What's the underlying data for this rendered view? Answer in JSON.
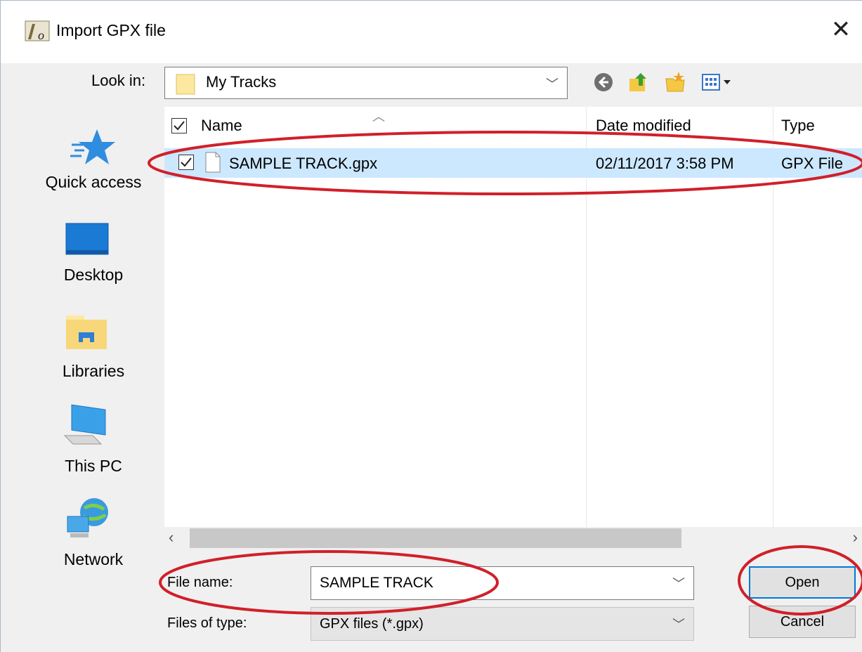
{
  "window": {
    "title": "Import GPX file"
  },
  "lookin": {
    "label": "Look in:",
    "value": "My Tracks"
  },
  "places": [
    {
      "label": "Quick access",
      "icon": "star-icon"
    },
    {
      "label": "Desktop",
      "icon": "desktop-icon"
    },
    {
      "label": "Libraries",
      "icon": "libraries-icon"
    },
    {
      "label": "This PC",
      "icon": "computer-icon"
    },
    {
      "label": "Network",
      "icon": "network-icon"
    }
  ],
  "list": {
    "columns": {
      "name": "Name",
      "date": "Date modified",
      "type": "Type"
    },
    "rows": [
      {
        "name": "SAMPLE TRACK.gpx",
        "date": "02/11/2017 3:58 PM",
        "type": "GPX File",
        "selected": true,
        "checked": true
      }
    ]
  },
  "filename": {
    "label": "File name:",
    "value": "SAMPLE TRACK"
  },
  "filetype": {
    "label": "Files of type:",
    "value": "GPX files (*.gpx)"
  },
  "buttons": {
    "open": "Open",
    "cancel": "Cancel"
  },
  "colors": {
    "selection": "#cce8ff",
    "annotation": "#d0202a",
    "focus": "#0078d7"
  }
}
